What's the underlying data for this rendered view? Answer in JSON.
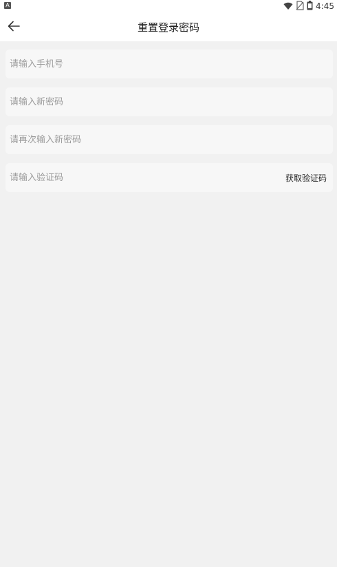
{
  "status_bar": {
    "left_icon": "A",
    "time": "4:45",
    "icons": [
      "wifi-icon",
      "no-sim-icon",
      "battery-icon"
    ]
  },
  "app_bar": {
    "title": "重置登录密码",
    "back_icon": "arrow-left-icon"
  },
  "form": {
    "phone_placeholder": "请输入手机号",
    "new_password_placeholder": "请输入新密码",
    "confirm_password_placeholder": "请再次输入新密码",
    "code_placeholder": "请输入验证码",
    "get_code_label": "获取验证码"
  },
  "colors": {
    "background": "#f1f1f1",
    "field": "#f7f7f7",
    "placeholder": "#9b9b9b",
    "text": "#222222"
  }
}
